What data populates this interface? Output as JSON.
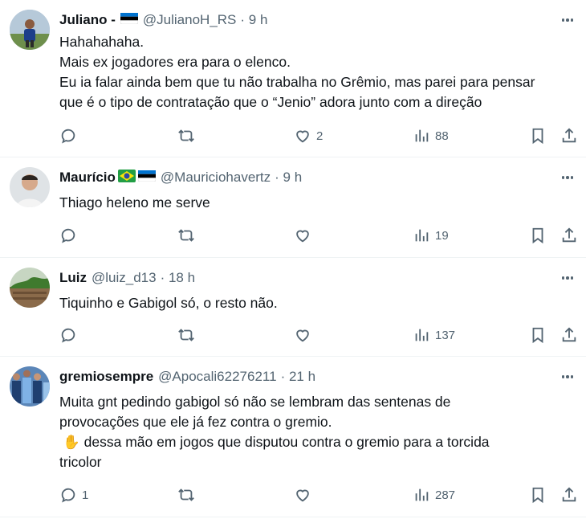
{
  "replies": [
    {
      "name": "Juliano -",
      "handle": "@JulianoH_RS",
      "time": "· 9 h",
      "lines": [
        "Hahahahaha.",
        "Mais ex jogadores era para o elenco.",
        "Eu ia falar ainda bem que tu não trabalha no Grêmio, mas parei para pensar",
        "que é o tipo de contratação que o “Jenio” adora junto com a direção"
      ],
      "reply_count": "",
      "retweet_count": "",
      "like_count": "2",
      "view_count": "88",
      "icons": [
        "estonia-flag-icon"
      ]
    },
    {
      "name": "Maurício",
      "handle": "@Mauriciohavertz",
      "time": "· 9 h",
      "lines": [
        "Thiago heleno me serve"
      ],
      "reply_count": "",
      "retweet_count": "",
      "like_count": "",
      "view_count": "19",
      "icons": [
        "brazil-flag-icon",
        "estonia-flag-icon"
      ]
    },
    {
      "name": "Luiz",
      "handle": "@luiz_d13",
      "time": "· 18 h",
      "lines": [
        "Tiquinho e Gabigol só, o resto não."
      ],
      "reply_count": "",
      "retweet_count": "",
      "like_count": "",
      "view_count": "137",
      "icons": []
    },
    {
      "name": "gremiosempre",
      "handle": "@Apocali62276211",
      "time": "· 21 h",
      "lines": [
        "Muita gnt pedindo gabigol só não se lembram das sentenas de",
        "provocações que ele já fez contra o gremio.",
        "✋ dessa mão em jogos que disputou contra o gremio para a torcida",
        "tricolor"
      ],
      "reply_count": "1",
      "retweet_count": "",
      "like_count": "",
      "view_count": "287",
      "icons": [
        "raised-hand-icon"
      ]
    }
  ],
  "colors": {
    "text": "#0f1419",
    "muted": "#536471",
    "divider": "#eff3f4"
  }
}
